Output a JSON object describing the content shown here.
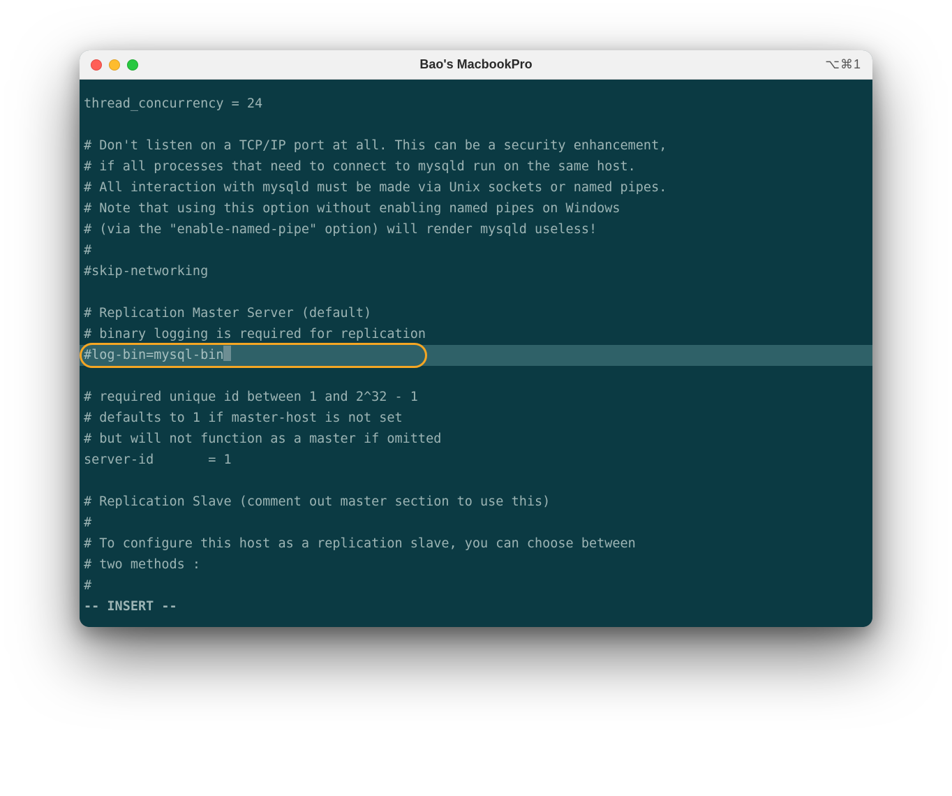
{
  "window": {
    "title": "Bao's MacbookPro",
    "shortcut": "⌥⌘1"
  },
  "terminal": {
    "lines": [
      "thread_concurrency = 24",
      "",
      "# Don't listen on a TCP/IP port at all. This can be a security enhancement,",
      "# if all processes that need to connect to mysqld run on the same host.",
      "# All interaction with mysqld must be made via Unix sockets or named pipes.",
      "# Note that using this option without enabling named pipes on Windows",
      "# (via the \"enable-named-pipe\" option) will render mysqld useless!",
      "#",
      "#skip-networking",
      "",
      "# Replication Master Server (default)",
      "# binary logging is required for replication",
      "#log-bin=mysql-bin",
      "",
      "# required unique id between 1 and 2^32 - 1",
      "# defaults to 1 if master-host is not set",
      "# but will not function as a master if omitted",
      "server-id       = 1",
      "",
      "# Replication Slave (comment out master section to use this)",
      "#",
      "# To configure this host as a replication slave, you can choose between",
      "# two methods :",
      "#"
    ],
    "highlighted_index": 12,
    "status_line": "-- INSERT --"
  },
  "annotation": {
    "callout_line_index": 12
  }
}
